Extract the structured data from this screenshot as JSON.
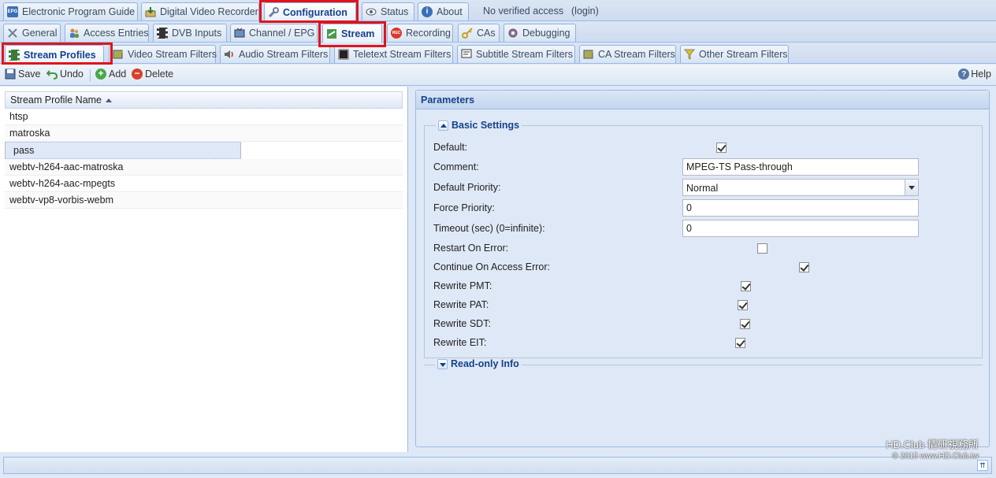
{
  "top_tabs": [
    {
      "label": "Electronic Program Guide",
      "icon": "epg-icon"
    },
    {
      "label": "Digital Video Recorder",
      "icon": "dvr-icon"
    },
    {
      "label": "Configuration",
      "icon": "wrench-icon",
      "active": true
    },
    {
      "label": "Status",
      "icon": "eye-icon"
    },
    {
      "label": "About",
      "icon": "info-icon"
    }
  ],
  "access_status": "No verified access",
  "login_label": "(login)",
  "config_tabs": [
    {
      "label": "General",
      "icon": "tools-icon"
    },
    {
      "label": "Access Entries",
      "icon": "users-icon"
    },
    {
      "label": "DVB Inputs",
      "icon": "film-icon"
    },
    {
      "label": "Channel / EPG",
      "icon": "tv-icon"
    },
    {
      "label": "Stream",
      "icon": "stream-icon",
      "active": true
    },
    {
      "label": "Recording",
      "icon": "rec-icon"
    },
    {
      "label": "CAs",
      "icon": "key-icon"
    },
    {
      "label": "Debugging",
      "icon": "bug-icon"
    }
  ],
  "stream_tabs": [
    {
      "label": "Stream Profiles",
      "icon": "film-strip-icon",
      "active": true
    },
    {
      "label": "Video Stream Filters",
      "icon": "video-filter-icon"
    },
    {
      "label": "Audio Stream Filters",
      "icon": "speaker-icon"
    },
    {
      "label": "Teletext Stream Filters",
      "icon": "teletext-icon"
    },
    {
      "label": "Subtitle Stream Filters",
      "icon": "subtitle-icon"
    },
    {
      "label": "CA Stream Filters",
      "icon": "ca-filter-icon"
    },
    {
      "label": "Other Stream Filters",
      "icon": "funnel-icon"
    }
  ],
  "toolbar": {
    "save_label": "Save",
    "undo_label": "Undo",
    "add_label": "Add",
    "delete_label": "Delete",
    "help_label": "Help"
  },
  "grid": {
    "column_header": "Stream Profile Name",
    "rows": [
      "htsp",
      "matroska",
      "pass",
      "webtv-h264-aac-matroska",
      "webtv-h264-aac-mpegts",
      "webtv-vp8-vorbis-webm"
    ],
    "selected_index": 2
  },
  "params": {
    "title": "Parameters",
    "basic_legend": "Basic Settings",
    "readonly_legend": "Read-only Info",
    "fields": {
      "default": {
        "label": "Default:",
        "checked": true
      },
      "comment": {
        "label": "Comment:",
        "value": "MPEG-TS Pass-through"
      },
      "priority": {
        "label": "Default Priority:",
        "value": "Normal"
      },
      "force_priority": {
        "label": "Force Priority:",
        "value": "0"
      },
      "timeout": {
        "label": "Timeout (sec) (0=infinite):",
        "value": "0"
      },
      "restart": {
        "label": "Restart On Error:",
        "checked": false
      },
      "continue": {
        "label": "Continue On Access Error:",
        "checked": true
      },
      "pmt": {
        "label": "Rewrite PMT:",
        "checked": true
      },
      "pat": {
        "label": "Rewrite PAT:",
        "checked": true
      },
      "sdt": {
        "label": "Rewrite SDT:",
        "checked": true
      },
      "eit": {
        "label": "Rewrite EIT:",
        "checked": true
      }
    }
  },
  "watermark": {
    "line1": "HD.Club 情研視務所",
    "line2": "© 2015 www.HD.Club.tw"
  },
  "colors": {
    "accent": "#15428b",
    "highlight_box": "#e0141e",
    "panel_bg": "#dfe8f6",
    "border": "#99bbe8"
  }
}
